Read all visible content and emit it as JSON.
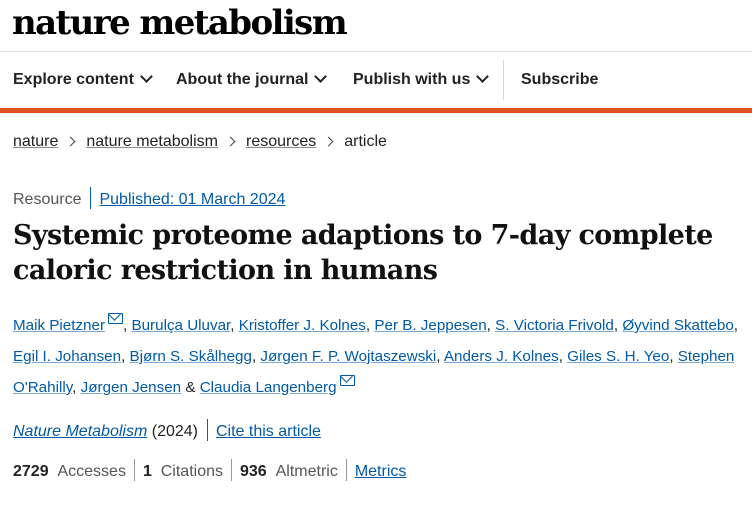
{
  "brand": "nature metabolism",
  "nav": {
    "explore": "Explore content",
    "about": "About the journal",
    "publish": "Publish with us",
    "subscribe": "Subscribe"
  },
  "breadcrumb": [
    "nature",
    "nature metabolism",
    "resources",
    "article"
  ],
  "article": {
    "type": "Resource",
    "published": "Published: 01 March 2024",
    "title": "Systemic proteome adaptions to 7-day complete caloric restriction in humans",
    "authors": [
      "Maik Pietzner",
      "Burulça Uluvar",
      "Kristoffer J. Kolnes",
      "Per B. Jeppesen",
      "S. Victoria Frivold",
      "Øyvind Skattebo",
      "Egil I. Johansen",
      "Bjørn S. Skålhegg",
      "Jørgen F. P. Wojtaszewski",
      "Anders J. Kolnes",
      "Giles S. H. Yeo",
      "Stephen O'Rahilly",
      "Jørgen Jensen",
      "Claudia Langenberg"
    ],
    "author_sep": ",",
    "author_last_sep": "&",
    "journal": "Nature Metabolism",
    "year": "(2024)",
    "cite": "Cite this article"
  },
  "metrics": {
    "accesses_count": "2729",
    "accesses_label": "Accesses",
    "citations_count": "1",
    "citations_label": "Citations",
    "altmetric_count": "936",
    "altmetric_label": "Altmetric",
    "metrics_link": "Metrics"
  },
  "colors": {
    "accent": "#e0521f",
    "link": "#005aa5"
  }
}
